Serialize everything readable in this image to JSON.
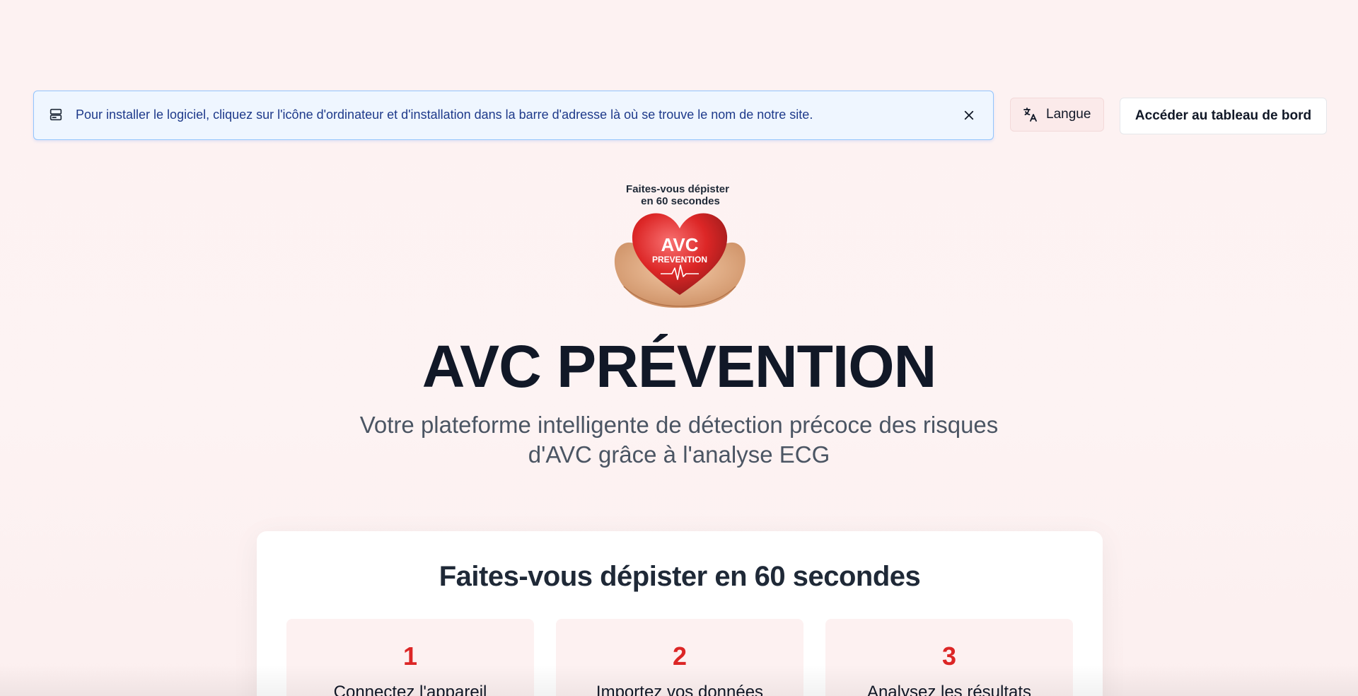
{
  "install_banner": {
    "icon": "computer-install-icon",
    "text": "Pour installer le logiciel, cliquez sur l'icône d'ordinateur et d'installation dans la barre d'adresse là où se trouve le nom de notre site.",
    "close_icon": "close-icon"
  },
  "header": {
    "language_label": "Langue",
    "language_icon": "translate-icon",
    "dashboard_label": "Accéder au tableau de bord"
  },
  "hero": {
    "logo": {
      "tagline_line1": "Faites-vous dépister",
      "tagline_line2": "en 60 secondes",
      "heart_title": "AVC",
      "heart_subtitle": "PREVENTION"
    },
    "title": "AVC PRÉVENTION",
    "subtitle": "Votre plateforme intelligente de détection précoce des risques d'AVC grâce à l'analyse ECG"
  },
  "screening": {
    "title": "Faites-vous dépister en 60 secondes",
    "steps": [
      {
        "number": "1",
        "label": "Connectez l'appareil"
      },
      {
        "number": "2",
        "label": "Importez vos données"
      },
      {
        "number": "3",
        "label": "Analysez les résultats"
      }
    ]
  },
  "colors": {
    "accent_red": "#dc2626",
    "banner_bg": "#eff6ff",
    "banner_text": "#1e3a8a"
  }
}
